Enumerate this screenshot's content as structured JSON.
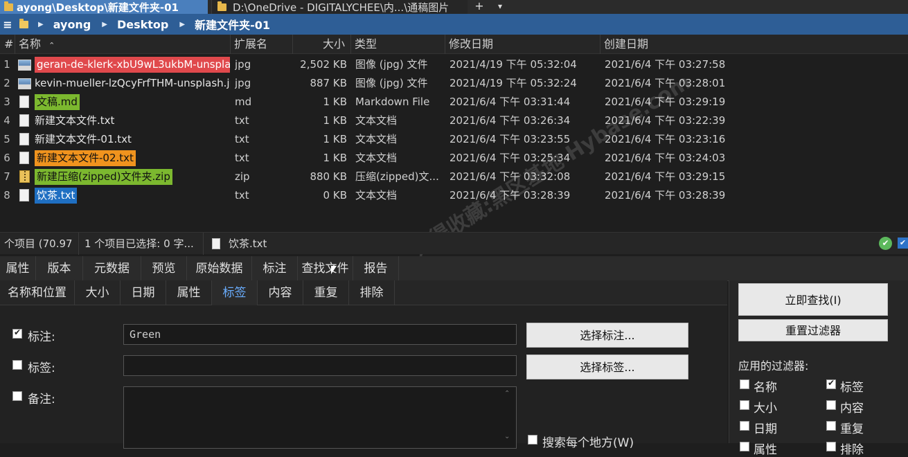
{
  "tabs": [
    {
      "label": "ayong\\Desktop\\新建文件夹-01"
    },
    {
      "label": "D:\\OneDrive - DIGITALYCHEE\\内...\\通稿图片"
    }
  ],
  "tab_add": "+",
  "tab_menu": "▾",
  "breadcrumb": [
    "ayong",
    "Desktop",
    "新建文件夹-01"
  ],
  "columns": {
    "hash": "#",
    "name": "名称",
    "ext": "扩展名",
    "size": "大小",
    "type": "类型",
    "modified": "修改日期",
    "created": "创建日期"
  },
  "files": [
    {
      "n": "1",
      "name": "geran-de-klerk-xbU9wL3ukbM-unsplash.jpg",
      "ext": "jpg",
      "size": "2,502 KB",
      "type": "图像 (jpg) 文件",
      "modified": "2021/4/19 下午 05:32:04",
      "created": "2021/6/4 下午 03:27:58",
      "icon": "image-icon",
      "tag_color": "#e0494c"
    },
    {
      "n": "2",
      "name": "kevin-mueller-lzQcyFrfTHM-unsplash.jpg",
      "ext": "jpg",
      "size": "887 KB",
      "type": "图像 (jpg) 文件",
      "modified": "2021/4/19 下午 05:32:24",
      "created": "2021/6/4 下午 03:28:01",
      "icon": "image-icon",
      "tag_color": ""
    },
    {
      "n": "3",
      "name": "文稿.md",
      "ext": "md",
      "size": "1 KB",
      "type": "Markdown File",
      "modified": "2021/6/4 下午 03:31:44",
      "created": "2021/6/4 下午 03:29:19",
      "icon": "markdown-file-icon",
      "tag_color": "#7cb82f"
    },
    {
      "n": "4",
      "name": "新建文本文件.txt",
      "ext": "txt",
      "size": "1 KB",
      "type": "文本文档",
      "modified": "2021/6/4 下午 03:26:34",
      "created": "2021/6/4 下午 03:22:39",
      "icon": "text-file-icon",
      "tag_color": ""
    },
    {
      "n": "5",
      "name": "新建文本文件-01.txt",
      "ext": "txt",
      "size": "1 KB",
      "type": "文本文档",
      "modified": "2021/6/4 下午 03:23:55",
      "created": "2021/6/4 下午 03:23:16",
      "icon": "text-file-icon",
      "tag_color": ""
    },
    {
      "n": "6",
      "name": "新建文本文件-02.txt",
      "ext": "txt",
      "size": "1 KB",
      "type": "文本文档",
      "modified": "2021/6/4 下午 03:25:34",
      "created": "2021/6/4 下午 03:24:03",
      "icon": "text-file-icon",
      "tag_color": "#f0931e"
    },
    {
      "n": "7",
      "name": "新建压缩(zipped)文件夹.zip",
      "ext": "zip",
      "size": "880 KB",
      "type": "压缩(zipped)文...",
      "modified": "2021/6/4 下午 03:32:08",
      "created": "2021/6/4 下午 03:29:15",
      "icon": "zip-file-icon",
      "tag_color": "#7cb82f"
    },
    {
      "n": "8",
      "name": "饮茶.txt",
      "ext": "txt",
      "size": "0 KB",
      "type": "文本文档",
      "modified": "2021/6/4 下午 03:28:39",
      "created": "2021/6/4 下午 03:28:39",
      "icon": "text-file-icon",
      "tag_color": "#1f6fc2"
    }
  ],
  "status": {
    "items": "个项目 (70.97",
    "selected": "1 个项目已选择: 0 字...",
    "current_file": "饮茶.txt"
  },
  "info_tabs": [
    "属性",
    "版本",
    "元数据",
    "预览",
    "原始数据",
    "标注",
    "查找文件",
    "报告"
  ],
  "search_tabs": [
    "名称和位置",
    "大小",
    "日期",
    "属性",
    "标签",
    "内容",
    "重复",
    "排除"
  ],
  "search_tabs_selected": "标签",
  "tag_form": {
    "label_annotation": "标注:",
    "annotation_value": "Green",
    "annotation_checked": true,
    "label_tags": "标签:",
    "tags_value": "",
    "tags_checked": false,
    "label_comment": "备注:",
    "comment_checked": false,
    "btn_choose_annotation": "选择标注...",
    "btn_choose_tags": "选择标签...",
    "search_everywhere": "搜索每个地方(W)"
  },
  "right_panel": {
    "btn_search": "立即查找(I)",
    "btn_reset": "重置过滤器",
    "filters_title": "应用的过滤器:",
    "filters": [
      {
        "label": "名称",
        "checked": false
      },
      {
        "label": "标签",
        "checked": true
      },
      {
        "label": "大小",
        "checked": false
      },
      {
        "label": "内容",
        "checked": false
      },
      {
        "label": "日期",
        "checked": false
      },
      {
        "label": "重复",
        "checked": false
      },
      {
        "label": "属性",
        "checked": false
      },
      {
        "label": "排除",
        "checked": false
      }
    ]
  },
  "watermark": "记得收藏:黑区基地 Hybase.com",
  "colors": {
    "breadcrumb_bg": "#2e5e96",
    "active_tab": "#4a7fbd",
    "selected_subtab": "#6aaeff",
    "status_ok": "#5cb85c"
  }
}
